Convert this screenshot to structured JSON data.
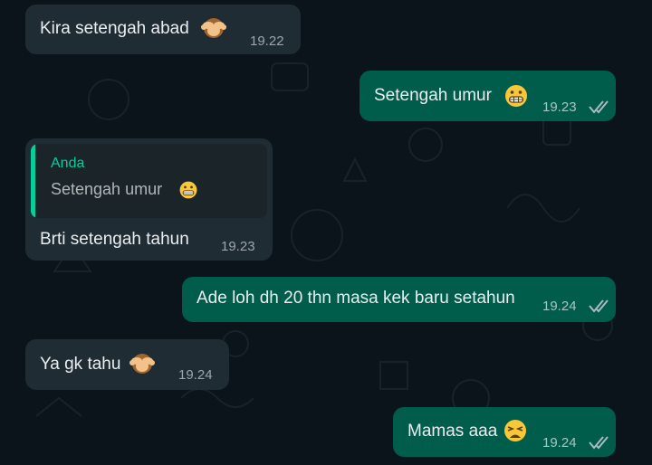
{
  "chat": {
    "messages": [
      {
        "direction": "in",
        "text": "Kira setengah abad",
        "emoji": "see-no-evil-monkey",
        "time": "19.22"
      },
      {
        "direction": "out",
        "text": "Setengah umur",
        "emoji": "grimacing-face",
        "time": "19.23",
        "status": "read"
      },
      {
        "direction": "in",
        "quote_author": "Anda",
        "quote_text": "Setengah umur",
        "quote_emoji": "grimacing-face",
        "text": "Brti setengah tahun",
        "time": "19.23"
      },
      {
        "direction": "out",
        "text": "Ade loh dh 20 thn masa kek baru setahun",
        "time": "19.24",
        "status": "read"
      },
      {
        "direction": "in",
        "text": "Ya gk tahu",
        "emoji": "see-no-evil-monkey",
        "time": "19.24"
      },
      {
        "direction": "out",
        "text": "Mamas aaa",
        "emoji": "weary-face",
        "time": "19.24",
        "status": "read"
      }
    ]
  },
  "colors": {
    "background": "#0b141a",
    "incoming_bubble": "#1f2c34",
    "outgoing_bubble": "#005c4b",
    "quote_accent": "#06cf9c"
  }
}
